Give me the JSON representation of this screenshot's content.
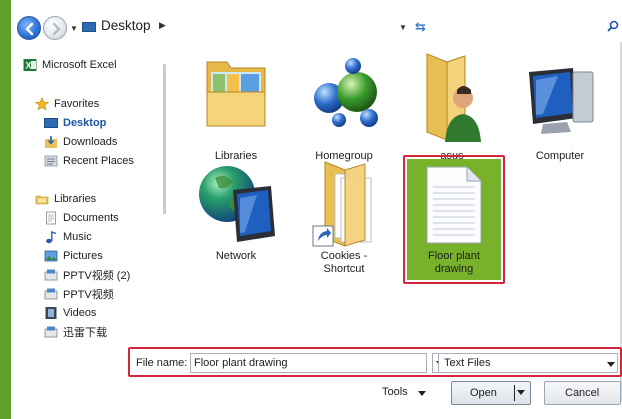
{
  "address_bar": {
    "location": "Desktop",
    "search_placeholder": ""
  },
  "sidebar": {
    "items": [
      {
        "label": "Microsoft Excel",
        "icon": "excel-icon"
      },
      {
        "label": "Favorites",
        "icon": "star-icon"
      },
      {
        "label": "Desktop",
        "icon": "desktop-icon",
        "selected": true
      },
      {
        "label": "Downloads",
        "icon": "downloads-icon"
      },
      {
        "label": "Recent Places",
        "icon": "recent-places-icon"
      },
      {
        "label": "Libraries",
        "icon": "libraries-icon"
      },
      {
        "label": "Documents",
        "icon": "documents-icon"
      },
      {
        "label": "Music",
        "icon": "music-icon"
      },
      {
        "label": "Pictures",
        "icon": "pictures-icon"
      },
      {
        "label": "PPTV视频 (2)",
        "icon": "drive-icon"
      },
      {
        "label": "PPTV视频",
        "icon": "drive-icon"
      },
      {
        "label": "Videos",
        "icon": "videos-icon"
      },
      {
        "label": "迅雷下载",
        "icon": "drive-icon"
      }
    ]
  },
  "items": [
    {
      "label": "Libraries",
      "icon": "libraries-folder-icon"
    },
    {
      "label": "Homegroup",
      "icon": "homegroup-icon"
    },
    {
      "label": "asus",
      "icon": "user-folder-icon"
    },
    {
      "label": "Computer",
      "icon": "computer-icon"
    },
    {
      "label": "Network",
      "icon": "network-icon"
    },
    {
      "label_line1": "Cookies -",
      "label_line2": "Shortcut",
      "icon": "shortcut-folder-icon"
    },
    {
      "label_line1": "Floor plant",
      "label_line2": "drawing",
      "icon": "text-document-icon",
      "selected": true
    }
  ],
  "footer": {
    "file_name_label": "File name:",
    "file_name_value": "Floor plant drawing",
    "file_type_value": "Text Files",
    "tools_label": "Tools",
    "open_label": "Open",
    "cancel_label": "Cancel"
  },
  "colors": {
    "accent_green": "#78b22b",
    "highlight_red": "#d4263a",
    "selected_text": "#1e55a5"
  }
}
